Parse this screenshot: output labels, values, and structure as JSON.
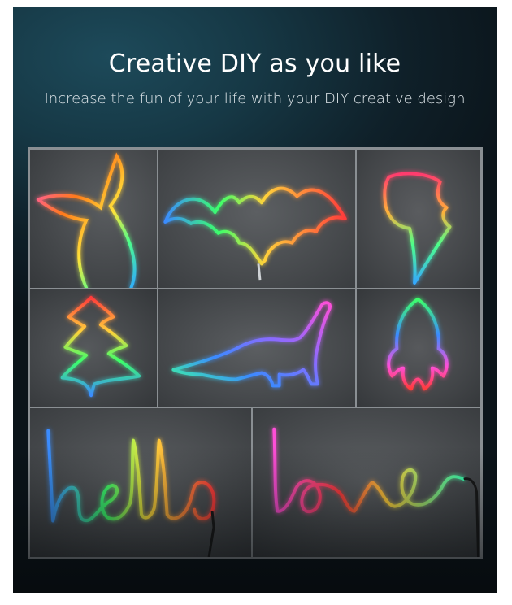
{
  "banner": {
    "title": "Creative DIY as you like",
    "subtitle": "Increase the fun of your life with your DIY creative design"
  },
  "tiles": [
    {
      "name": "mermaid-tail-neon",
      "colors": [
        "#ff4fd8",
        "#ff7a1a",
        "#ffe23a",
        "#4dff8a",
        "#2fa8ff"
      ]
    },
    {
      "name": "bat-neon",
      "colors": [
        "#ff3b3b",
        "#ffd23a",
        "#3cff6a",
        "#3a8bff"
      ]
    },
    {
      "name": "lightning-bolt-neon",
      "colors": [
        "#ff3b6e",
        "#ffb03a",
        "#4dff8a",
        "#35a8ff"
      ]
    },
    {
      "name": "christmas-tree-neon",
      "colors": [
        "#ff3b3b",
        "#ffd23a",
        "#3cff6a",
        "#3a8bff"
      ]
    },
    {
      "name": "dinosaur-neon",
      "colors": [
        "#ff4fd8",
        "#8a6bff",
        "#3a8bff",
        "#3cff9a"
      ]
    },
    {
      "name": "rocket-neon",
      "colors": [
        "#3cff6a",
        "#3a8bff",
        "#ff4fd8",
        "#ff3b3b"
      ]
    },
    {
      "name": "hello-neon",
      "colors": [
        "#3a8bff",
        "#3cff6a",
        "#ffe23a",
        "#ff3b3b"
      ]
    },
    {
      "name": "love-neon",
      "colors": [
        "#ff4fd8",
        "#ff3b3b",
        "#ffd23a",
        "#3cffb0"
      ]
    }
  ]
}
